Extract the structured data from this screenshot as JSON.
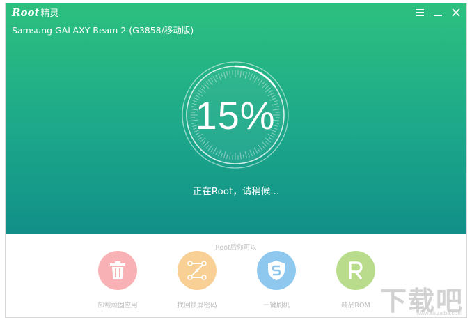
{
  "app": {
    "logo_text": "Root",
    "logo_suffix": "精灵"
  },
  "device": {
    "name": "Samsung GALAXY Beam 2 (G3858/移动版)"
  },
  "progress": {
    "percent_label": "15%",
    "value": 0.15,
    "status_text": "正在Root，请稍候..."
  },
  "bottom": {
    "heading": "Root后你可以",
    "features": [
      {
        "label": "卸载顽固应用",
        "icon": "trash-icon",
        "color": "#f8b2b5"
      },
      {
        "label": "找回锁屏密码",
        "icon": "unlock-pattern-icon",
        "color": "#f8cf95"
      },
      {
        "label": "一键刷机",
        "icon": "shield-s-icon",
        "color": "#8ec8ee"
      },
      {
        "label": "精品ROM",
        "icon": "rom-r-icon",
        "color": "#b9dc8c"
      }
    ]
  },
  "watermark": {
    "big_text": "下载吧",
    "small_text": "www.xiazaiba.com"
  },
  "colors": {
    "hero_top": "#2cc07f",
    "hero_bottom": "#118f88"
  }
}
